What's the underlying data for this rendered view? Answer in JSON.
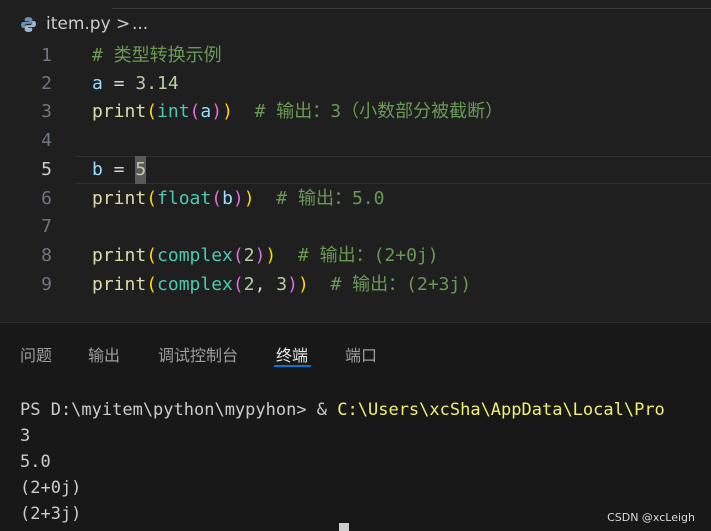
{
  "breadcrumb": {
    "file": "item.py",
    "separator": ">",
    "more": "..."
  },
  "editor": {
    "active_line": 5,
    "lines": [
      {
        "num": "1",
        "tokens": [
          {
            "t": "# 类型转换示例",
            "c": "c-com"
          }
        ]
      },
      {
        "num": "2",
        "tokens": [
          {
            "t": "a",
            "c": "c-var"
          },
          {
            "t": " = ",
            "c": "c-op"
          },
          {
            "t": "3.14",
            "c": "c-num"
          }
        ]
      },
      {
        "num": "3",
        "tokens": [
          {
            "t": "print",
            "c": "c-fn"
          },
          {
            "t": "(",
            "c": "c-p1"
          },
          {
            "t": "int",
            "c": "c-bi"
          },
          {
            "t": "(",
            "c": "c-p2"
          },
          {
            "t": "a",
            "c": "c-var"
          },
          {
            "t": ")",
            "c": "c-p2"
          },
          {
            "t": ")",
            "c": "c-p1"
          },
          {
            "t": "  # 输出：3（小数部分被截断）",
            "c": "c-com"
          }
        ]
      },
      {
        "num": "4",
        "tokens": []
      },
      {
        "num": "5",
        "tokens": [
          {
            "t": "b",
            "c": "c-var"
          },
          {
            "t": " = ",
            "c": "c-op"
          },
          {
            "t": "5",
            "c": "c-num cursor"
          }
        ]
      },
      {
        "num": "6",
        "tokens": [
          {
            "t": "print",
            "c": "c-fn"
          },
          {
            "t": "(",
            "c": "c-p1"
          },
          {
            "t": "float",
            "c": "c-bi"
          },
          {
            "t": "(",
            "c": "c-p2"
          },
          {
            "t": "b",
            "c": "c-var"
          },
          {
            "t": ")",
            "c": "c-p2"
          },
          {
            "t": ")",
            "c": "c-p1"
          },
          {
            "t": "  # 输出：5.0",
            "c": "c-com"
          }
        ]
      },
      {
        "num": "7",
        "tokens": []
      },
      {
        "num": "8",
        "tokens": [
          {
            "t": "print",
            "c": "c-fn"
          },
          {
            "t": "(",
            "c": "c-p1"
          },
          {
            "t": "complex",
            "c": "c-bi"
          },
          {
            "t": "(",
            "c": "c-p2"
          },
          {
            "t": "2",
            "c": "c-num"
          },
          {
            "t": ")",
            "c": "c-p2"
          },
          {
            "t": ")",
            "c": "c-p1"
          },
          {
            "t": "  # 输出：(2+0j)",
            "c": "c-com"
          }
        ]
      },
      {
        "num": "9",
        "tokens": [
          {
            "t": "print",
            "c": "c-fn"
          },
          {
            "t": "(",
            "c": "c-p1"
          },
          {
            "t": "complex",
            "c": "c-bi"
          },
          {
            "t": "(",
            "c": "c-p2"
          },
          {
            "t": "2",
            "c": "c-num"
          },
          {
            "t": ", ",
            "c": "c-op"
          },
          {
            "t": "3",
            "c": "c-num"
          },
          {
            "t": ")",
            "c": "c-p2"
          },
          {
            "t": ")",
            "c": "c-p1"
          },
          {
            "t": "  # 输出：(2+3j)",
            "c": "c-com"
          }
        ]
      }
    ]
  },
  "panel": {
    "tabs": [
      {
        "label": "问题",
        "active": false
      },
      {
        "label": "输出",
        "active": false
      },
      {
        "label": "调试控制台",
        "active": false
      },
      {
        "label": "终端",
        "active": true
      },
      {
        "label": "端口",
        "active": false
      }
    ]
  },
  "terminal": {
    "prompt": "PS D:\\myitem\\python\\mypyhon> & ",
    "command": "C:\\Users\\xcSha\\AppData\\Local\\Pro",
    "output": [
      "3",
      "5.0",
      "(2+0j)",
      "(2+3j)"
    ]
  },
  "watermark": "CSDN @xcLeigh",
  "colors": {
    "accent": "#0078d4",
    "background": "#1f1f1f",
    "panel": "#181818",
    "terminal_exe": "#f1f16b"
  }
}
